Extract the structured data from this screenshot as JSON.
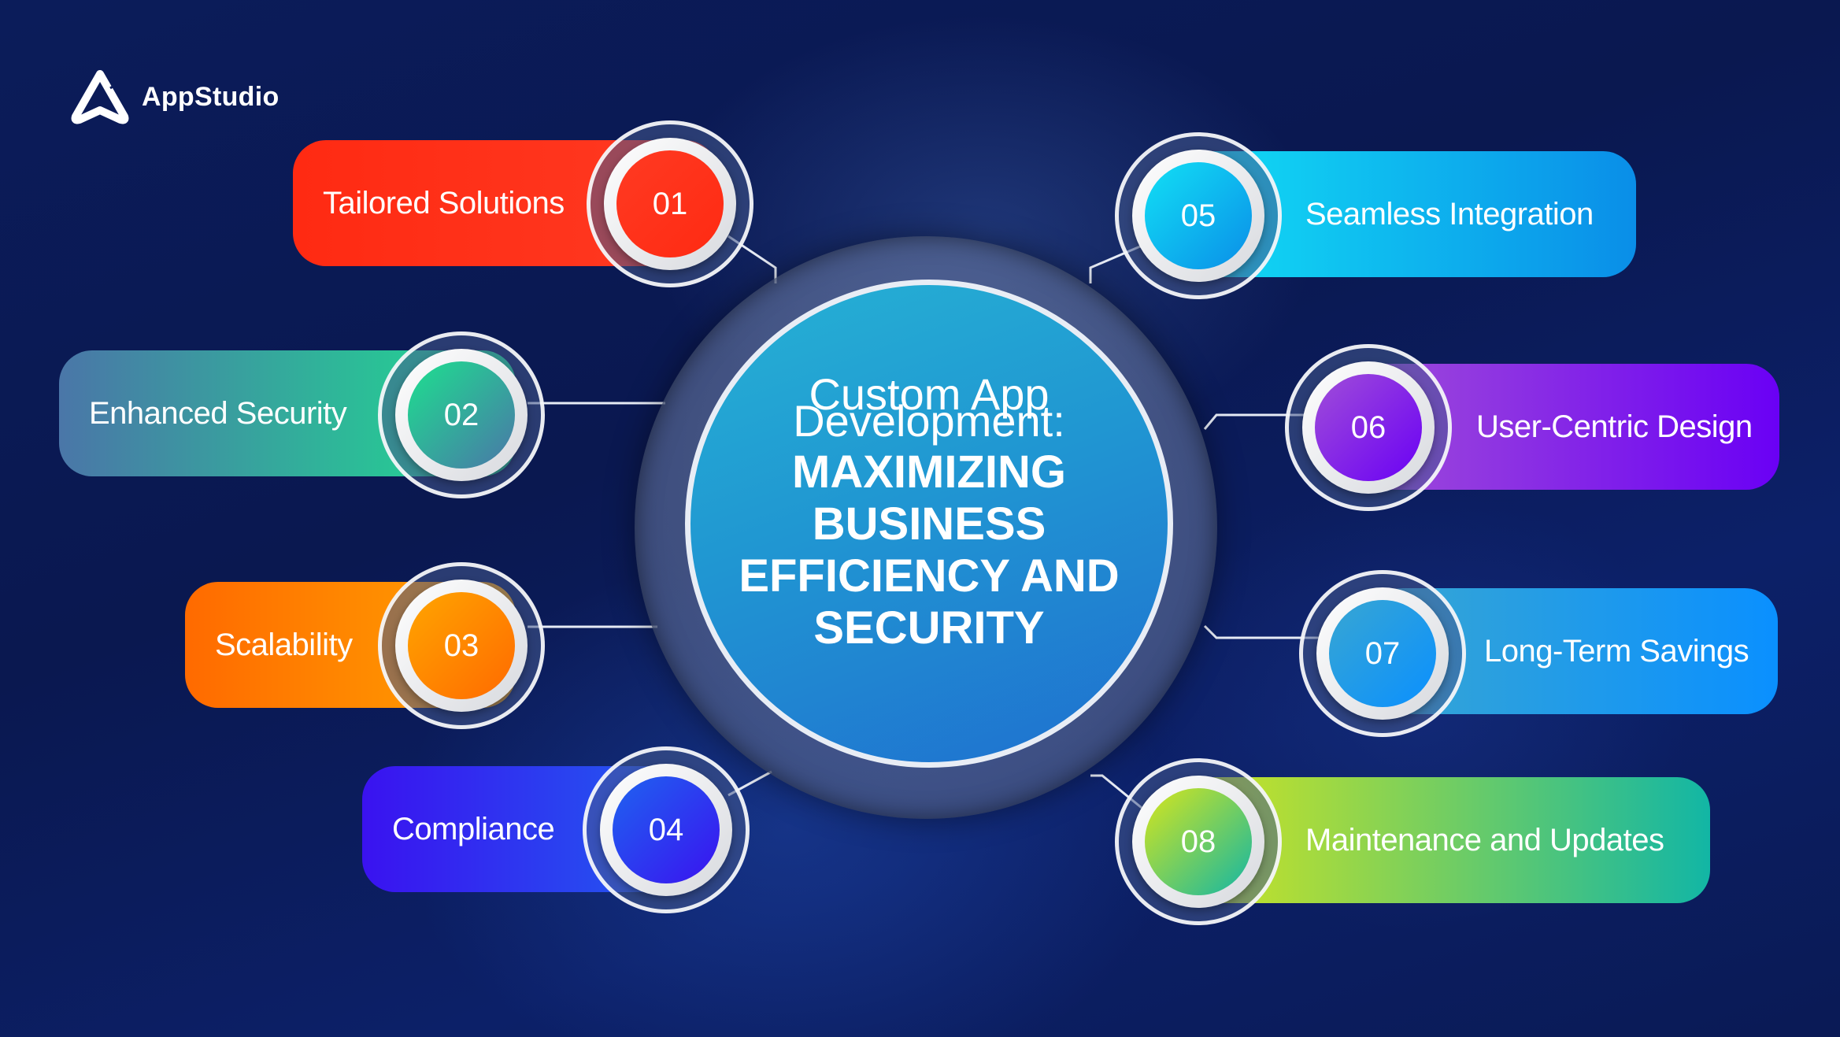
{
  "brand": {
    "name": "AppStudio",
    "icon": "appstudio-logo-icon"
  },
  "hub": {
    "title_line1": "Custom App",
    "title_line2": "Development:",
    "subtitle_line1": "MAXIMIZING",
    "subtitle_line2": "BUSINESS",
    "subtitle_line3": "EFFICIENCY AND",
    "subtitle_line4": "SECURITY"
  },
  "items": [
    {
      "number": "01",
      "label": "Tailored Solutions",
      "side": "left",
      "colors": [
        "#ff2a12",
        "#ff3a22"
      ]
    },
    {
      "number": "02",
      "label": "Enhanced Security",
      "side": "left",
      "colors": [
        "#4a76a8",
        "#1de08f"
      ]
    },
    {
      "number": "03",
      "label": "Scalability",
      "side": "left",
      "colors": [
        "#ff6a00",
        "#ffa500"
      ]
    },
    {
      "number": "04",
      "label": "Compliance",
      "side": "left",
      "colors": [
        "#3a12f0",
        "#1f63f0"
      ]
    },
    {
      "number": "05",
      "label": "Seamless Integration",
      "side": "right",
      "colors": [
        "#12e0f5",
        "#0a8ee8"
      ]
    },
    {
      "number": "06",
      "label": "User-Centric Design",
      "side": "right",
      "colors": [
        "#a04ed8",
        "#6a00f5"
      ]
    },
    {
      "number": "07",
      "label": "Long-Term Savings",
      "side": "right",
      "colors": [
        "#38a6d2",
        "#0a90ff"
      ]
    },
    {
      "number": "08",
      "label": "Maintenance and Updates",
      "side": "right",
      "colors": [
        "#d7e61c",
        "#12b6a5"
      ]
    }
  ]
}
